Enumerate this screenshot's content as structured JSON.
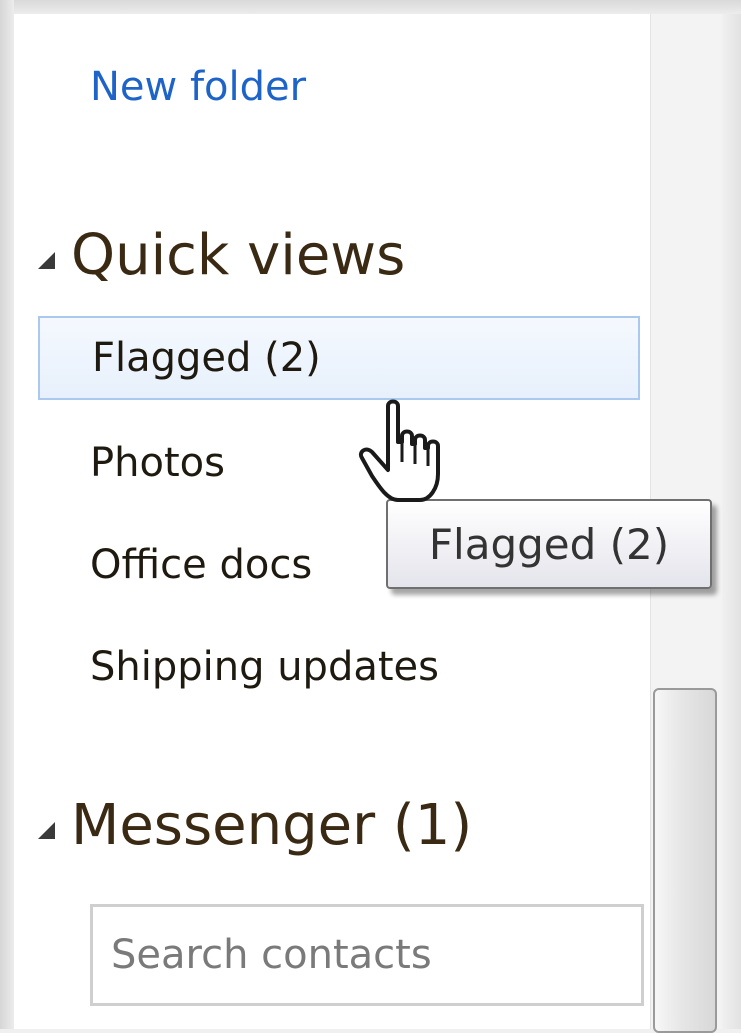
{
  "sidebar": {
    "new_folder_label": "New folder",
    "quick_views": {
      "title": "Quick views",
      "items": [
        {
          "label": "Flagged (2)",
          "selected": true
        },
        {
          "label": "Photos"
        },
        {
          "label": "Office docs"
        },
        {
          "label": "Shipping updates"
        }
      ]
    },
    "messenger": {
      "title": "Messenger (1)",
      "search_placeholder": "Search contacts"
    }
  },
  "tooltip": {
    "text": "Flagged (2)"
  },
  "icons": {
    "section_expand": "expanded-triangle-icon",
    "pointer": "hand-pointer-icon"
  },
  "colors": {
    "link": "#1e64c8",
    "selection_border": "#a9c9ee",
    "selection_fill": "#e7f0fc"
  }
}
